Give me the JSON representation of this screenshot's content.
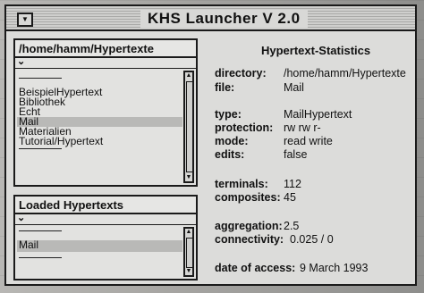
{
  "window": {
    "title": "KHS Launcher V 2.0",
    "close_glyph": "▼"
  },
  "hypertexte_pane": {
    "path": "/home/hamm/Hypertexte",
    "items": [
      "BeispielHypertext",
      "Bibliothek",
      "Echt",
      "Mail",
      "Materialien",
      "Tutorial/Hypertext"
    ],
    "selected": "Mail"
  },
  "loaded_pane": {
    "title": "Loaded Hypertexts",
    "items": [
      "Mail"
    ],
    "selected": "Mail"
  },
  "stats": {
    "title": "Hypertext-Statistics",
    "directory_label": "directory:",
    "directory": "/home/hamm/Hypertexte",
    "file_label": "file:",
    "file": "Mail",
    "type_label": "type:",
    "type": "MailHypertext",
    "protection_label": "protection:",
    "protection": "rw rw r-",
    "mode_label": "mode:",
    "mode": "read write",
    "edits_label": "edits:",
    "edits": "false",
    "terminals_label": "terminals:",
    "terminals": "112",
    "composites_label": "composites:",
    "composites": "45",
    "aggregation_label": "aggregation:",
    "aggregation": "2.5",
    "connectivity_label": "connectivity:",
    "connectivity": "0.025 / 0",
    "date_label": "date of access:",
    "date": "9 March 1993"
  }
}
